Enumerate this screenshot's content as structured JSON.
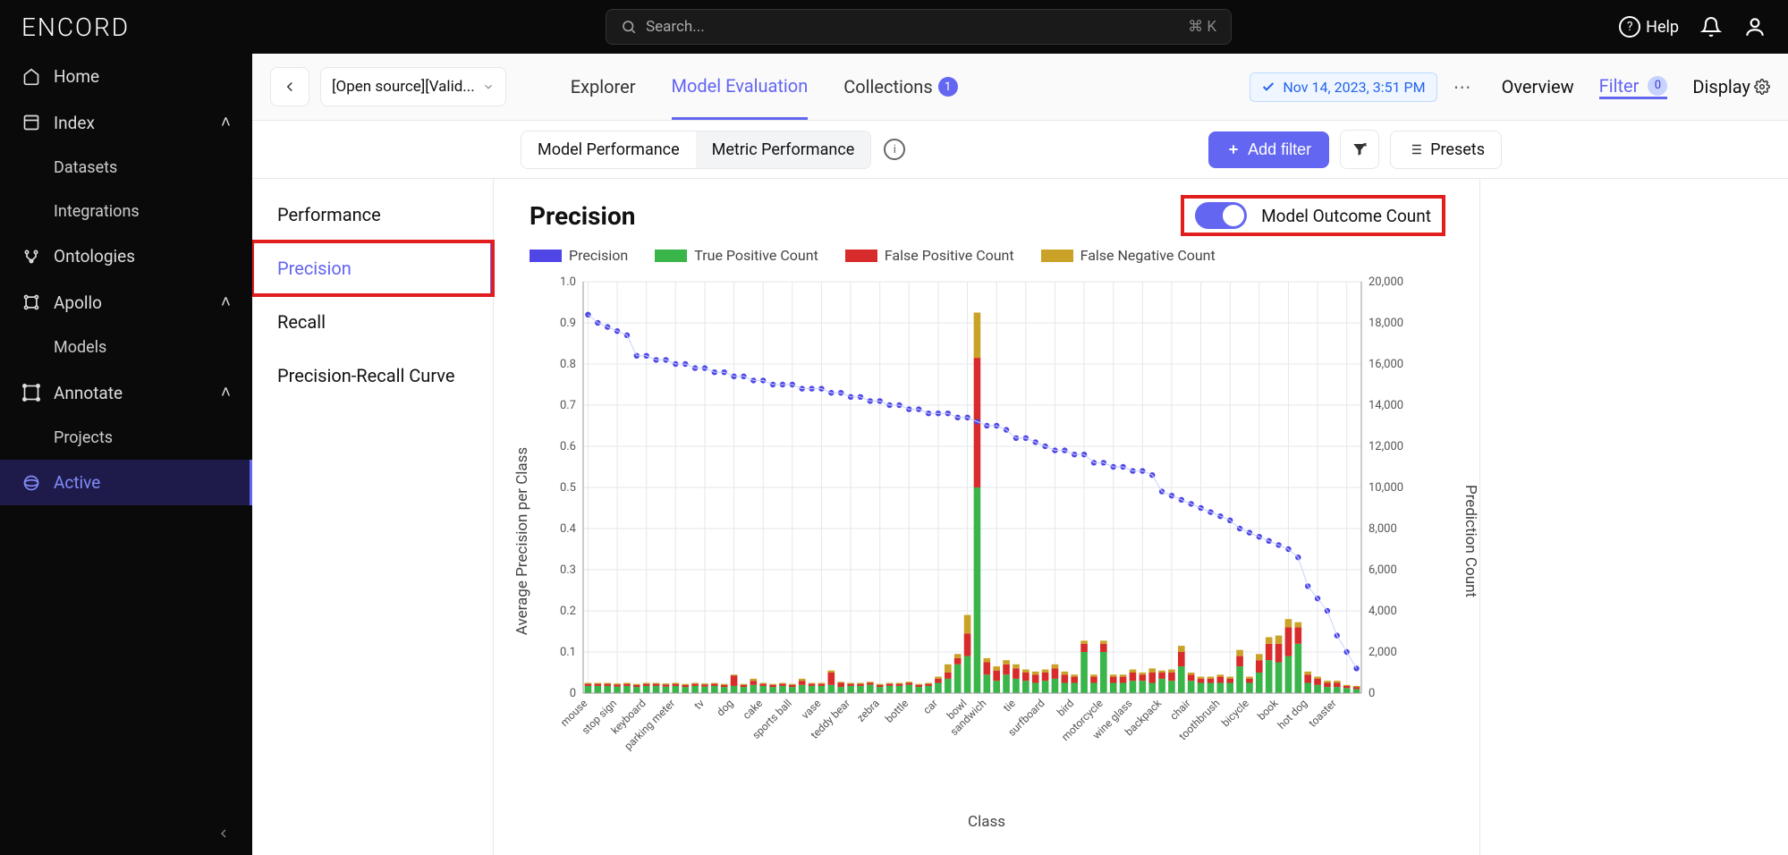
{
  "brand": "ENCORD",
  "search": {
    "placeholder": "Search...",
    "shortcut": "⌘ K"
  },
  "topRight": {
    "help": "Help"
  },
  "sidebar": {
    "home": "Home",
    "index": "Index",
    "datasets": "Datasets",
    "integrations": "Integrations",
    "ontologies": "Ontologies",
    "apollo": "Apollo",
    "models": "Models",
    "annotate": "Annotate",
    "projects": "Projects",
    "active": "Active"
  },
  "subheader": {
    "projectLabel": "[Open source][Valid...",
    "tabs": {
      "explorer": "Explorer",
      "modelEval": "Model Evaluation",
      "collections": "Collections",
      "collectionsBadge": "1"
    },
    "timestamp": "Nov 14, 2023, 3:51 PM",
    "rtabs": {
      "overview": "Overview",
      "filter": "Filter",
      "filterBadge": "0",
      "display": "Display"
    }
  },
  "toolbar": {
    "segments": {
      "modelPerf": "Model Performance",
      "metricPerf": "Metric Performance"
    },
    "addFilter": "Add filter",
    "presets": "Presets"
  },
  "leftPane": {
    "performance": "Performance",
    "precision": "Precision",
    "recall": "Recall",
    "prcurve": "Precision-Recall Curve"
  },
  "chart": {
    "title": "Precision",
    "moc": "Model Outcome Count",
    "legend": {
      "precision": "Precision",
      "tp": "True Positive Count",
      "fp": "False Positive Count",
      "fn": "False Negative Count"
    },
    "yLabel": "Average Precision per Class",
    "y2Label": "Prediction Count",
    "xLabel": "Class",
    "yTicks": [
      "0",
      "0.1",
      "0.2",
      "0.3",
      "0.4",
      "0.5",
      "0.6",
      "0.7",
      "0.8",
      "0.9",
      "1.0"
    ],
    "y2Ticks": [
      "0",
      "2,000",
      "4,000",
      "6,000",
      "8,000",
      "10,000",
      "12,000",
      "14,000",
      "16,000",
      "18,000",
      "20,000"
    ]
  },
  "colors": {
    "precision": "#4f46e5",
    "tp": "#39b54a",
    "fp": "#d82b2b",
    "fn": "#c9a227",
    "grid": "#e5e7eb"
  },
  "chart_data": {
    "type": "bar",
    "title": "Precision",
    "xlabel": "Class",
    "ylabel_left": "Average Precision per Class",
    "ylabel_right": "Prediction Count",
    "ylim_left": [
      0,
      1.0
    ],
    "ylim_right": [
      0,
      20000
    ],
    "visible_categories": [
      "mouse",
      "stop sign",
      "keyboard",
      "parking meter",
      "tv",
      "dog",
      "cake",
      "sports ball",
      "vase",
      "teddy bear",
      "zebra",
      "bottle",
      "car",
      "bowl",
      "sandwich",
      "tie",
      "surfboard",
      "bird",
      "motorcycle",
      "wine glass",
      "backpack",
      "chair",
      "toothbrush",
      "bicycle",
      "book",
      "hot dog",
      "toaster"
    ],
    "series": {
      "precision_line": [
        0.92,
        0.9,
        0.89,
        0.88,
        0.87,
        0.82,
        0.82,
        0.81,
        0.81,
        0.8,
        0.8,
        0.79,
        0.79,
        0.78,
        0.78,
        0.77,
        0.77,
        0.76,
        0.76,
        0.75,
        0.75,
        0.75,
        0.74,
        0.74,
        0.74,
        0.73,
        0.73,
        0.72,
        0.72,
        0.71,
        0.71,
        0.7,
        0.7,
        0.69,
        0.69,
        0.68,
        0.68,
        0.68,
        0.67,
        0.67,
        0.66,
        0.65,
        0.65,
        0.64,
        0.62,
        0.62,
        0.61,
        0.6,
        0.59,
        0.59,
        0.58,
        0.58,
        0.56,
        0.56,
        0.55,
        0.55,
        0.54,
        0.54,
        0.53,
        0.49,
        0.48,
        0.47,
        0.46,
        0.45,
        0.44,
        0.43,
        0.42,
        0.4,
        0.39,
        0.38,
        0.37,
        0.36,
        0.35,
        0.33,
        0.26,
        0.23,
        0.2,
        0.14,
        0.1,
        0.06
      ],
      "true_positive_count": [
        350,
        350,
        350,
        320,
        350,
        300,
        350,
        350,
        320,
        350,
        300,
        350,
        320,
        350,
        300,
        350,
        300,
        400,
        350,
        300,
        350,
        300,
        400,
        350,
        350,
        400,
        300,
        350,
        350,
        400,
        300,
        350,
        350,
        400,
        300,
        350,
        500,
        700,
        1400,
        1800,
        10000,
        900,
        600,
        900,
        700,
        600,
        500,
        600,
        700,
        500,
        500,
        2000,
        500,
        2000,
        500,
        500,
        600,
        600,
        500,
        700,
        600,
        1300,
        600,
        500,
        500,
        500,
        500,
        1300,
        500,
        1000,
        1600,
        1500,
        1800,
        2400,
        500,
        400,
        300,
        300,
        250,
        200
      ],
      "false_positive_count": [
        100,
        100,
        100,
        100,
        100,
        100,
        100,
        100,
        100,
        100,
        100,
        100,
        100,
        100,
        100,
        500,
        100,
        200,
        100,
        100,
        100,
        100,
        200,
        100,
        100,
        600,
        200,
        100,
        100,
        100,
        100,
        100,
        100,
        100,
        100,
        100,
        200,
        300,
        300,
        1100,
        6300,
        600,
        500,
        500,
        500,
        400,
        400,
        400,
        500,
        400,
        300,
        400,
        300,
        400,
        300,
        300,
        400,
        300,
        500,
        300,
        400,
        700,
        300,
        200,
        200,
        300,
        200,
        500,
        200,
        600,
        800,
        900,
        1400,
        800,
        400,
        300,
        200,
        200,
        100,
        100
      ],
      "false_negative_count": [
        50,
        50,
        50,
        50,
        50,
        50,
        50,
        50,
        50,
        50,
        50,
        50,
        50,
        50,
        50,
        50,
        50,
        100,
        50,
        50,
        50,
        50,
        100,
        50,
        50,
        100,
        50,
        50,
        50,
        50,
        50,
        50,
        50,
        50,
        50,
        50,
        100,
        400,
        200,
        900,
        2200,
        200,
        200,
        200,
        200,
        150,
        150,
        150,
        200,
        150,
        100,
        150,
        100,
        150,
        100,
        100,
        150,
        100,
        200,
        100,
        150,
        300,
        100,
        100,
        100,
        100,
        100,
        300,
        100,
        300,
        320,
        400,
        400,
        250,
        150,
        100,
        100,
        100,
        50,
        50
      ]
    }
  }
}
